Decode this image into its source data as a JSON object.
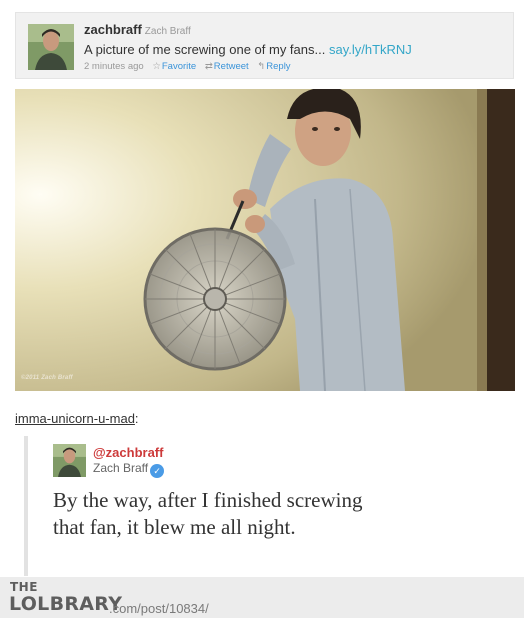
{
  "tweet": {
    "handle": "zachbraff",
    "name": "Zach Braff",
    "text": "A picture of me screwing one of my fans...",
    "link": "say.ly/hTkRNJ",
    "time": "2 minutes ago",
    "favorite_label": "Favorite",
    "retweet_label": "Retweet",
    "reply_label": "Reply"
  },
  "photo": {
    "copyright": "©2011 Zach Braff"
  },
  "reply": {
    "reblogger": "imma-unicorn-u-mad",
    "separator": ":",
    "quoted_handle": "@zachbraff",
    "quoted_name": "Zach Braff",
    "quoted_text": "By the way, after I finished screwing that fan, it blew me all night."
  },
  "footer": {
    "logo_the": "THE",
    "logo_main": "LOLBRARY",
    "url": ".com/post/10834/"
  },
  "icons": {
    "favorite": "star-icon",
    "retweet": "retweet-icon",
    "reply": "reply-arrow-icon",
    "verified": "verified-check-icon"
  },
  "colors": {
    "link": "#33a6c8",
    "action": "#3b94d9",
    "quoted_handle": "#cd3a3a",
    "verified": "#4a9be6"
  }
}
